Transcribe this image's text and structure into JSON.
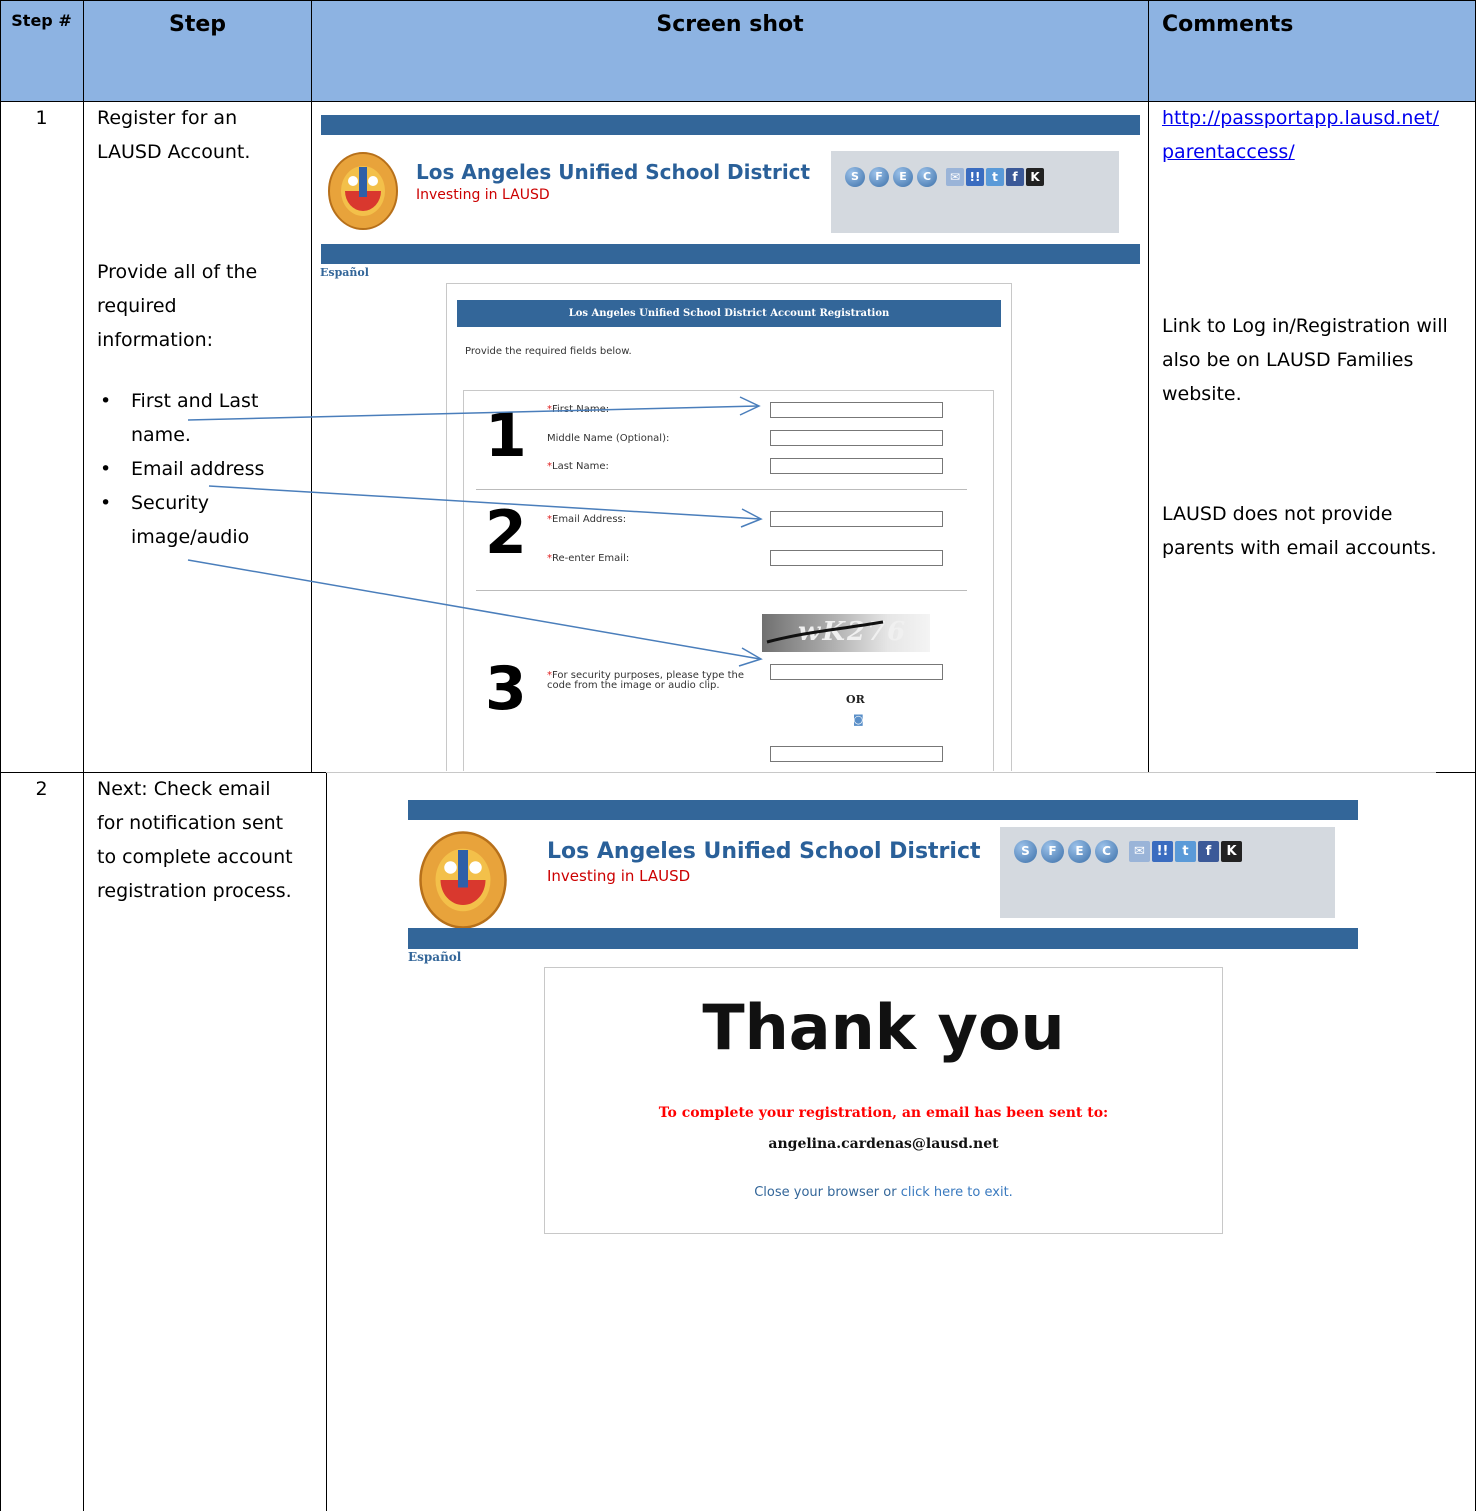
{
  "table": {
    "headers": {
      "step_num": "Step #",
      "step": "Step",
      "screenshot": "Screen shot",
      "comments": "Comments"
    },
    "rows": [
      {
        "num": "1",
        "step_text_1": "Register for an LAUSD Account.",
        "step_text_2": "Provide all of the required information:",
        "bullets": [
          "First and Last name.",
          "Email address",
          "Security image/audio"
        ],
        "comment_link_line1": "http://passportapp.lausd.net/",
        "comment_link_line2": "parentaccess/",
        "comment_2": "Link to Log in/Registration will also be on LAUSD Families website.",
        "comment_3": "LAUSD does not provide parents with email accounts."
      },
      {
        "num": "2",
        "step_text_1": "Next: Check email for notification sent to complete account registration process."
      }
    ]
  },
  "site": {
    "title": "Los Angeles Unified School District",
    "subtitle": "Investing in LAUSD",
    "language_link": "Español",
    "icons": [
      "S",
      "F",
      "E",
      "C",
      "mail-icon",
      "myspace-icon",
      "twitter-icon",
      "facebook-icon",
      "k-icon"
    ]
  },
  "registration": {
    "header": "Los Angeles Unified School District Account Registration",
    "intro": "Provide the required fields below.",
    "sections": [
      "1",
      "2",
      "3"
    ],
    "first_name_label": "First Name:",
    "middle_name_label": "Middle Name (Optional):",
    "last_name_label": "Last Name:",
    "email_label": "Email Address:",
    "reenter_email_label": "Re-enter Email:",
    "security_label": "For security purposes, please type the code from the image or audio clip.",
    "captcha_text": "wK276",
    "or_label": "OR",
    "required_marker": "*"
  },
  "thankyou": {
    "heading": "Thank you",
    "message": "To complete your registration, an email has been sent to:",
    "email": "angelina.cardenas@lausd.net",
    "close_text": "Close your browser or ",
    "exit_link": "click here to exit."
  },
  "colors": {
    "header_fill": "#8db3e2",
    "site_band": "#336699",
    "required": "#e02020",
    "arrow": "#4a7ebb"
  }
}
